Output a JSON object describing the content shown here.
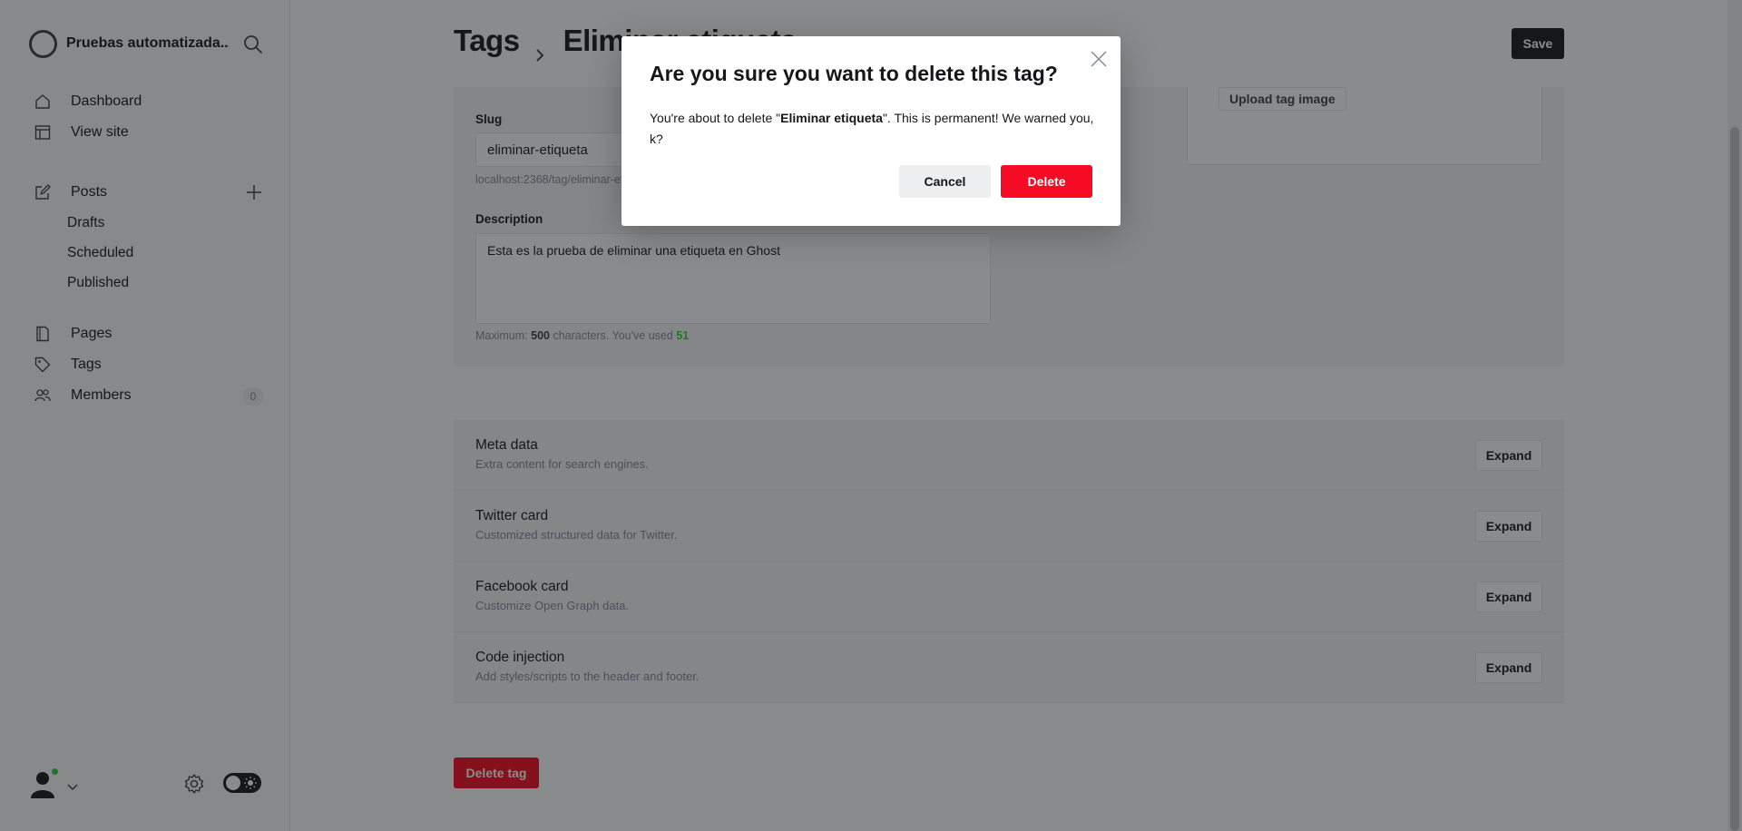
{
  "sidebar": {
    "site_title": "Pruebas automatizada...",
    "nav": {
      "dashboard": "Dashboard",
      "view_site": "View site",
      "posts": "Posts",
      "drafts": "Drafts",
      "scheduled": "Scheduled",
      "published": "Published",
      "pages": "Pages",
      "tags": "Tags",
      "members": "Members",
      "members_count": "0"
    }
  },
  "header": {
    "breadcrumb_parent": "Tags",
    "breadcrumb_current": "Eliminar etiqueta",
    "save_label": "Save"
  },
  "form": {
    "slug_label": "Slug",
    "slug_value": "eliminar-etiqueta",
    "slug_url": "localhost:2368/tag/eliminar-etiqueta/",
    "description_label": "Description",
    "description_value": "Esta es la prueba de eliminar una etiqueta en Ghost",
    "desc_hint_prefix": "Maximum: ",
    "desc_hint_max": "500",
    "desc_hint_mid": " characters. You've used ",
    "desc_hint_used": "51",
    "upload_label": "Upload tag image"
  },
  "sections": [
    {
      "title": "Meta data",
      "subtitle": "Extra content for search engines.",
      "button": "Expand"
    },
    {
      "title": "Twitter card",
      "subtitle": "Customized structured data for Twitter.",
      "button": "Expand"
    },
    {
      "title": "Facebook card",
      "subtitle": "Customize Open Graph data.",
      "button": "Expand"
    },
    {
      "title": "Code injection",
      "subtitle": "Add styles/scripts to the header and footer.",
      "button": "Expand"
    }
  ],
  "delete_tag_label": "Delete tag",
  "modal": {
    "title": "Are you sure you want to delete this tag?",
    "body_prefix": "You're about to delete \"",
    "body_tag": "Eliminar etiqueta",
    "body_suffix": "\". This is permanent! We warned you, k?",
    "cancel_label": "Cancel",
    "delete_label": "Delete"
  },
  "colors": {
    "accent_green": "#30cf43",
    "danger_red": "#f50b23",
    "dark": "#15171a"
  }
}
